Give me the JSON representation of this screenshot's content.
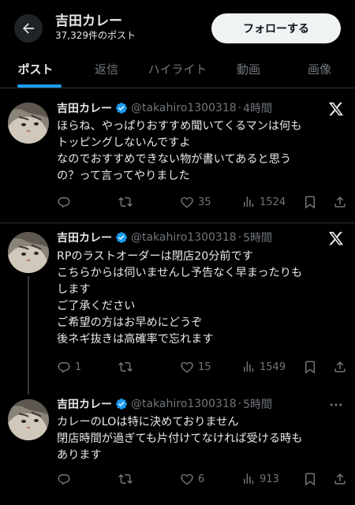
{
  "header": {
    "title": "吉田カレー",
    "post_count": "37,329件のポスト",
    "follow_label": "フォローする"
  },
  "tabs": [
    {
      "label": "ポスト",
      "active": true
    },
    {
      "label": "返信",
      "active": false
    },
    {
      "label": "ハイライト",
      "active": false
    },
    {
      "label": "動画",
      "active": false
    },
    {
      "label": "画像",
      "active": false
    }
  ],
  "tweets": [
    {
      "name": "吉田カレー",
      "handle": "@takahiro1300318",
      "time": "4時間",
      "lines": [
        "ほらね、やっぱりおすすめ聞いてくるマンは何も",
        "トッピングしないんですよ",
        "なのでおすすめできない物が書いてあると思う",
        "の？って言ってやりました"
      ],
      "replies": "",
      "retweets": "",
      "likes": "35",
      "views": "1524",
      "corner_icon": "x-logo-icon"
    },
    {
      "name": "吉田カレー",
      "handle": "@takahiro1300318",
      "time": "5時間",
      "lines": [
        "RPのラストオーダーは閉店20分前です",
        "こちらからは伺いませんし予告なく早まったりも",
        "します",
        "ご了承ください",
        "ご希望の方はお早めにどうぞ",
        "後ネギ抜きは高確率で忘れます"
      ],
      "replies": "1",
      "retweets": "",
      "likes": "15",
      "views": "1549",
      "corner_icon": "x-logo-icon"
    },
    {
      "name": "吉田カレー",
      "handle": "@takahiro1300318",
      "time": "5時間",
      "lines": [
        "カレーのLOは特に決めておりません",
        "閉店時間が過ぎても片付けてなければ受ける時も",
        "あります"
      ],
      "replies": "",
      "retweets": "",
      "likes": "6",
      "views": "913",
      "corner_icon": "more-icon"
    }
  ],
  "colors": {
    "background": "#000000",
    "text": "#e7e9ea",
    "secondary": "#71767b",
    "accent": "#1d9bf0",
    "divider": "#2f3336"
  }
}
